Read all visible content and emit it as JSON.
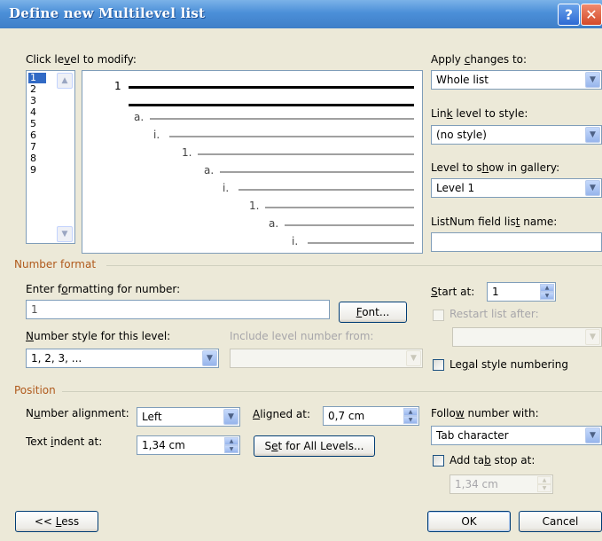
{
  "window": {
    "title": "Define new Multilevel list"
  },
  "level_picker": {
    "label_pre": "Click le",
    "label_u": "v",
    "label_post": "el to modify:",
    "levels": [
      "1",
      "2",
      "3",
      "4",
      "5",
      "6",
      "7",
      "8",
      "9"
    ],
    "selected": "1"
  },
  "preview": {
    "level1_label": "1",
    "labels": [
      "a.",
      "i.",
      "1.",
      "a.",
      "i.",
      "1.",
      "a.",
      "i."
    ]
  },
  "apply_changes": {
    "label_pre": "Apply ",
    "label_u": "c",
    "label_post": "hanges to:",
    "value": "Whole list"
  },
  "link_level": {
    "label_pre": "Lin",
    "label_u": "k",
    "label_post": " level to style:",
    "value": "(no style)"
  },
  "gallery_level": {
    "label_pre": "Level to s",
    "label_u": "h",
    "label_post": "ow in gallery:",
    "value": "Level 1"
  },
  "listnum": {
    "label_pre": "ListNum field lis",
    "label_u": "t",
    "label_post": " name:",
    "value": ""
  },
  "number_format": {
    "group_label": "Number format",
    "enter_label_pre": "Enter f",
    "enter_label_u": "o",
    "enter_label_post": "rmatting for number:",
    "enter_value": "1",
    "font_button_u": "F",
    "font_button_post": "ont...",
    "style_label_u": "N",
    "style_label_post": "umber style for this level:",
    "style_value": "1, 2, 3, ...",
    "include_label": "Include level number from:",
    "include_value": "",
    "start_label_u": "S",
    "start_label_post": "tart at:",
    "start_value": "1",
    "restart_label": "Restart list after:",
    "restart_value": "",
    "legal_label_pre": "Le",
    "legal_label_u": "g",
    "legal_label_post": "al style numbering"
  },
  "position": {
    "group_label": "Position",
    "alignment_label_pre": "N",
    "alignment_label_u": "u",
    "alignment_label_post": "mber alignment:",
    "alignment_value": "Left",
    "aligned_at_label_u": "A",
    "aligned_at_label_post": "ligned at:",
    "aligned_at_value": "0,7 cm",
    "text_indent_label_pre": "Text ",
    "text_indent_label_u": "i",
    "text_indent_label_post": "ndent at:",
    "text_indent_value": "1,34 cm",
    "set_all_pre": "S",
    "set_all_u": "e",
    "set_all_post": "t for All Levels...",
    "follow_label_pre": "Follo",
    "follow_label_u": "w",
    "follow_label_post": " number with:",
    "follow_value": "Tab character",
    "add_tab_pre": "Add ta",
    "add_tab_u": "b",
    "add_tab_post": " stop at:",
    "add_tab_value": "1,34 cm"
  },
  "footer": {
    "less_pre": "<< ",
    "less_u": "L",
    "less_post": "ess",
    "ok": "OK",
    "cancel": "Cancel"
  }
}
